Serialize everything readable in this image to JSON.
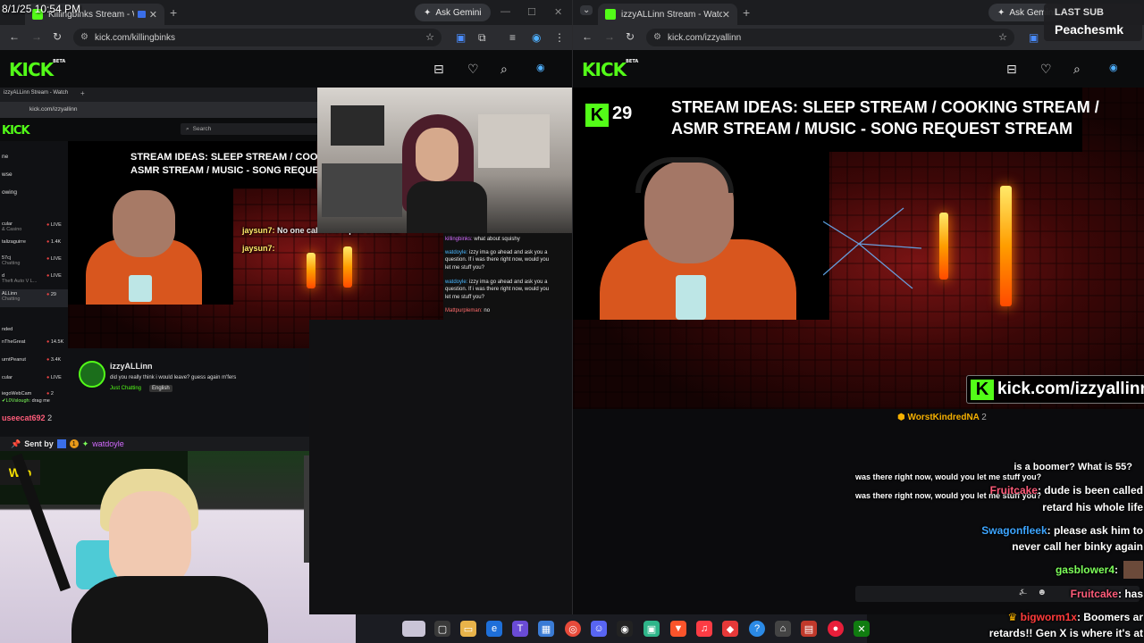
{
  "overlay": {
    "datetime": "8/1/25 10:54 PM",
    "last_sub_label": "LAST SUB",
    "last_sub_name": "Peachesmk"
  },
  "left_window": {
    "tab_title": "Killingbinks Stream - Watch",
    "ask_gemini": "Ask Gemini",
    "url": "kick.com/killingbinks",
    "logo": "KICK",
    "logo_beta": "BETA"
  },
  "right_window": {
    "tab_title": "izzyALLinn Stream - Watch Live",
    "ask_gemini": "Ask Gemini",
    "url": "kick.com/izzyallinn",
    "logo": "KICK",
    "logo_beta": "BETA"
  },
  "nested_browser": {
    "tab_title": "izzyALLinn Stream - Watch",
    "url": "kick.com/izzyallinn",
    "search_placeholder": "Search",
    "logo": "KICK",
    "stream_ideas_line1": "STREAM IDEAS: SLEEP STREAM / COOK",
    "stream_ideas_line2": "ASMR STREAM / MUSIC - SONG REQUE",
    "sidebar_nav": [
      "ne",
      "wse",
      "owing"
    ],
    "sidebar_channels": [
      {
        "name": "cular",
        "sub": "& Casino",
        "status": "LIVE"
      },
      {
        "name": "talizaguirre",
        "sub": "",
        "status": "1.4K"
      },
      {
        "name": "57cj",
        "sub": "Chatting",
        "status": "LIVE"
      },
      {
        "name": "d",
        "sub": "Theft Auto V L...",
        "status": "LIVE"
      },
      {
        "name": "ALLinn",
        "sub": "Chatting",
        "status": "29"
      }
    ],
    "sidebar_recommended_label": "nded",
    "sidebar_recommended": [
      {
        "name": "nTheGreat",
        "status": "14.5K"
      },
      {
        "name": "urntPeanut",
        "status": "3.4K"
      },
      {
        "name": "cular",
        "status": "LIVE"
      },
      {
        "name": "iegoWebCam",
        "status": "2"
      }
    ],
    "bottom_chat_fragment": "useecat692",
    "bottom_chat_count": "2",
    "bottom_chat_user": "✔L0Vslough:",
    "bottom_chat_text": "drag me",
    "channel_name": "izzyALLinn",
    "channel_title": "did you really think i would leave? guess again m'fers",
    "category": "Just Chatting",
    "language": "English",
    "chat": [
      {
        "user": "killingbinks:",
        "text": "what about squishy",
        "color": "#d36bff"
      },
      {
        "user": "watdoyle:",
        "text": "izzy ima go ahead and ask you a question. If i was there right now, would you let me stuff you?",
        "color": "#4ab8ff"
      },
      {
        "user": "watdoyle:",
        "text": "izzy ima go ahead and ask you a question. If i was there right now, would you let me stuff you?",
        "color": "#4ab8ff"
      },
      {
        "user": "Mattpurpleman:",
        "text": "no",
        "color": "#ff6b6b"
      }
    ],
    "jaysun_lines": [
      {
        "user": "jaysun7:",
        "text": "No one calls the Alpha a Retard."
      },
      {
        "user": "jaysun7:",
        "text": ""
      }
    ]
  },
  "pinned": {
    "label": "Sent by",
    "badge_count": "1",
    "user": "watdoyle"
  },
  "right_stream": {
    "viewer_count": "29",
    "title_line1": "STREAM IDEAS: SLEEP STREAM / COOKING STREAM /",
    "title_line2": "ASMR STREAM / MUSIC - SONG REQUEST STREAM",
    "kick_url_banner": "kick.com/izzyallinn",
    "top_user": "WorstKindredNA",
    "top_user_count": "2"
  },
  "chat_overlay": [
    {
      "user": "",
      "text": "is a boomer? What is 55?"
    },
    {
      "user": "",
      "text": "was there right now, would you let me stuff you?"
    },
    {
      "user": "",
      "text": "was there right now, would you let me stuff you?"
    },
    {
      "user": "Fruitcake",
      "text": ": dude is been called"
    },
    {
      "user": "",
      "text": "retard his whole life"
    },
    {
      "user": "Swagonfleek",
      "text": ": please ask him to"
    },
    {
      "user": "",
      "text": "never call her binky again"
    },
    {
      "user": "gasblower4",
      "text": ":"
    },
    {
      "user": "Fruitcake",
      "text": ": has"
    },
    {
      "user": "bigworm1x",
      "text": ": Boomers ar"
    },
    {
      "user": "",
      "text": "retards!! Gen X is where it's at"
    }
  ],
  "colors": {
    "kick_green": "#53fc18",
    "fruitcake": "#ff5c7a",
    "swagonfleek": "#3da5ff",
    "gasblower": "#7dff5a",
    "bigworm": "#ff3b3b"
  }
}
